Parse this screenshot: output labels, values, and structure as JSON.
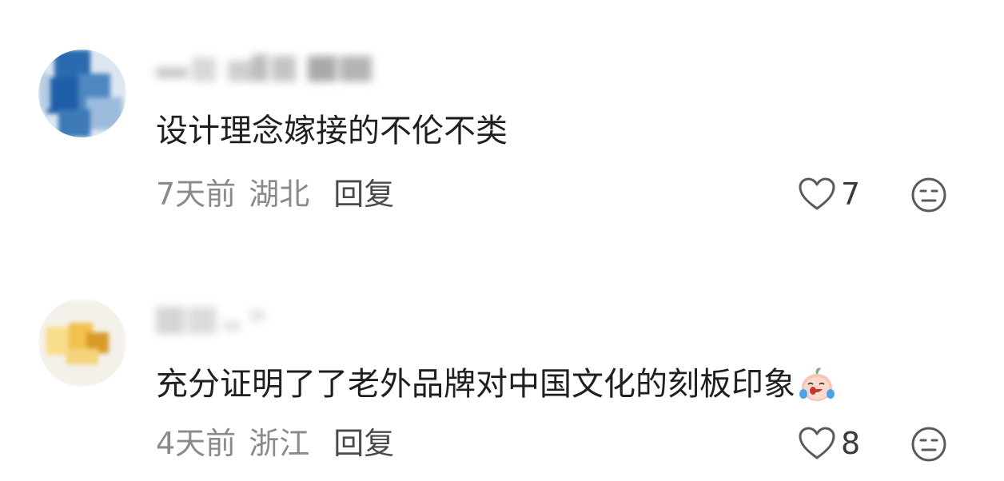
{
  "comments": [
    {
      "text": "设计理念嫁接的不伦不类",
      "time": "7天前",
      "location": "湖北",
      "reply_label": "回复",
      "likes": "7",
      "avatar_colors": [
        "#1e5fa8",
        "#7fa9d3",
        "#c8d8e8"
      ]
    },
    {
      "text": "充分证明了了老外品牌对中国文化的刻板印象",
      "emoji": "crying-laughing-emoji",
      "time": "4天前",
      "location": "浙江",
      "reply_label": "回复",
      "likes": "8",
      "avatar_colors": [
        "#f2c14e",
        "#f7dd8a",
        "#d89a2a"
      ]
    }
  ],
  "icons": {
    "like": "heart-outline-icon",
    "react": "neutral-face-icon"
  },
  "colors": {
    "text": "#1f1f1f",
    "meta": "#8a8a8a",
    "reply": "#4a4a4a",
    "icon": "#5a5a5a"
  }
}
